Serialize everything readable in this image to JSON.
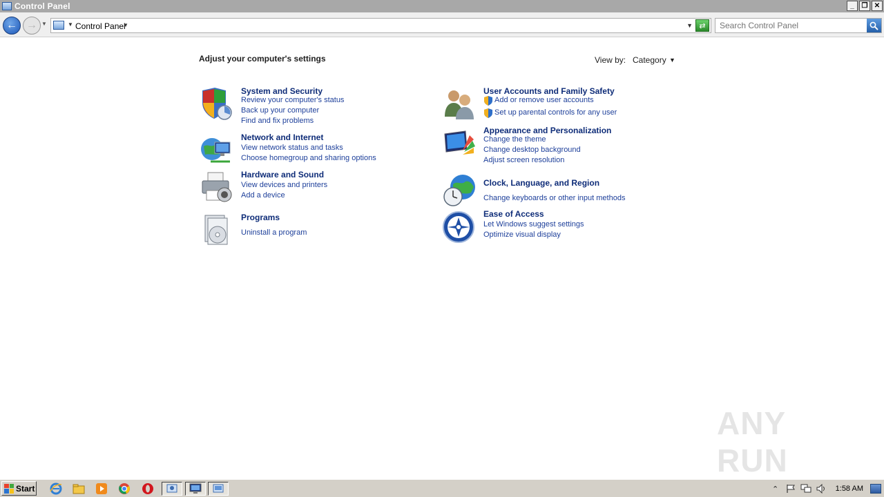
{
  "window": {
    "title": "Control Panel",
    "controls": {
      "minimize": "_",
      "maximize": "❐",
      "close": "✕"
    }
  },
  "address_bar": {
    "breadcrumb": "Control Panel",
    "search_placeholder": "Search Control Panel"
  },
  "main": {
    "heading": "Adjust your computer's settings",
    "view_by_label": "View by:",
    "view_by_value": "Category",
    "categories": [
      {
        "title": "System and Security",
        "icon": "shield-icon",
        "links": [
          "Review your computer's status",
          "Back up your computer",
          "Find and fix problems"
        ]
      },
      {
        "title": "Network and Internet",
        "icon": "network-globe-icon",
        "links": [
          "View network status and tasks",
          "Choose homegroup and sharing options"
        ]
      },
      {
        "title": "Hardware and Sound",
        "icon": "printer-speaker-icon",
        "links": [
          "View devices and printers",
          "Add a device"
        ]
      },
      {
        "title": "Programs",
        "icon": "programs-disc-icon",
        "links": [
          "Uninstall a program"
        ]
      },
      {
        "title": "User Accounts and Family Safety",
        "icon": "users-icon",
        "links": [
          "Add or remove user accounts",
          "Set up parental controls for any user"
        ]
      },
      {
        "title": "Appearance and Personalization",
        "icon": "monitor-palette-icon",
        "links": [
          "Change the theme",
          "Change desktop background",
          "Adjust screen resolution"
        ]
      },
      {
        "title": "Clock, Language, and Region",
        "icon": "clock-globe-icon",
        "links": [
          "Change keyboards or other input methods"
        ]
      },
      {
        "title": "Ease of Access",
        "icon": "ease-of-access-icon",
        "links": [
          "Let Windows suggest settings",
          "Optimize visual display"
        ]
      }
    ]
  },
  "watermark": "ANY RUN",
  "taskbar": {
    "start_label": "Start",
    "clock": "1:58 AM",
    "apps": [
      "internet-explorer-icon",
      "file-explorer-icon",
      "media-player-icon",
      "chrome-icon",
      "opera-icon",
      "control-panel-task-icon",
      "remote-desktop-task-icon",
      "control-panel-window-icon"
    ]
  },
  "colors": {
    "link": "#1d3f9a",
    "category_title": "#0e2c78",
    "titlebar": "#a8a8a8",
    "taskbar": "#d4d0c8"
  }
}
